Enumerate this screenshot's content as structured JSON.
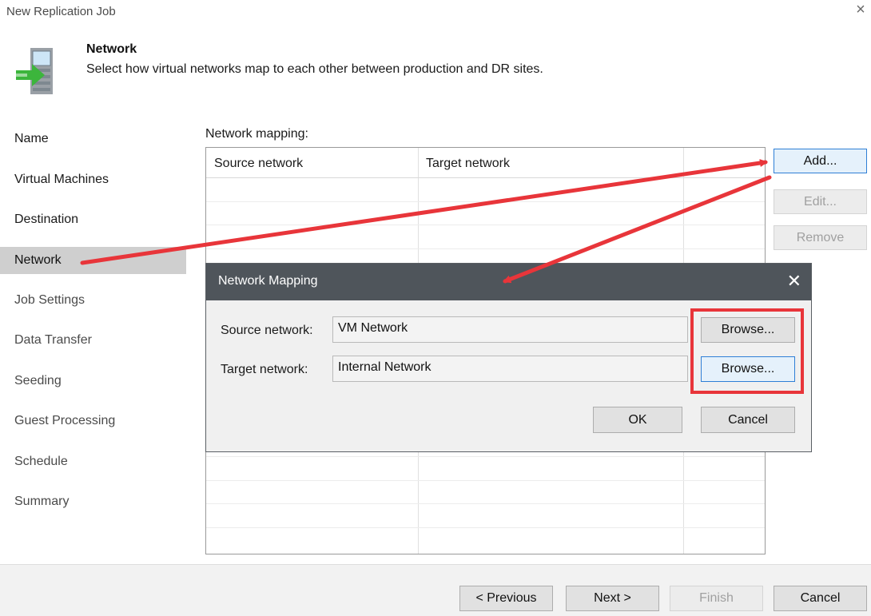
{
  "window": {
    "title": "New Replication Job",
    "close_icon": "×"
  },
  "header": {
    "title": "Network",
    "description": "Select how virtual networks map to each other between production and DR sites."
  },
  "sidebar": {
    "items": [
      {
        "label": "Name"
      },
      {
        "label": "Virtual Machines"
      },
      {
        "label": "Destination"
      },
      {
        "label": "Network"
      },
      {
        "label": "Job Settings"
      },
      {
        "label": "Data Transfer"
      },
      {
        "label": "Seeding"
      },
      {
        "label": "Guest Processing"
      },
      {
        "label": "Schedule"
      },
      {
        "label": "Summary"
      }
    ],
    "active": "Network"
  },
  "mapping": {
    "label": "Network mapping:",
    "columns": [
      "Source network",
      "Target network",
      ""
    ]
  },
  "side_buttons": {
    "add": "Add...",
    "edit": "Edit...",
    "remove": "Remove"
  },
  "dialog": {
    "title": "Network Mapping",
    "close_icon": "✕",
    "source_label": "Source network:",
    "source_value": "VM Network",
    "target_label": "Target network:",
    "target_value": "Internal Network",
    "browse_label": "Browse...",
    "ok_label": "OK",
    "cancel_label": "Cancel"
  },
  "footer": {
    "previous": "< Previous",
    "next": "Next >",
    "finish": "Finish",
    "cancel": "Cancel"
  },
  "colors": {
    "annotation": "#e8353a",
    "active_nav": "#cfcfcf",
    "dialog_title": "#4f555b",
    "arrow_green": "#3cb53c"
  }
}
